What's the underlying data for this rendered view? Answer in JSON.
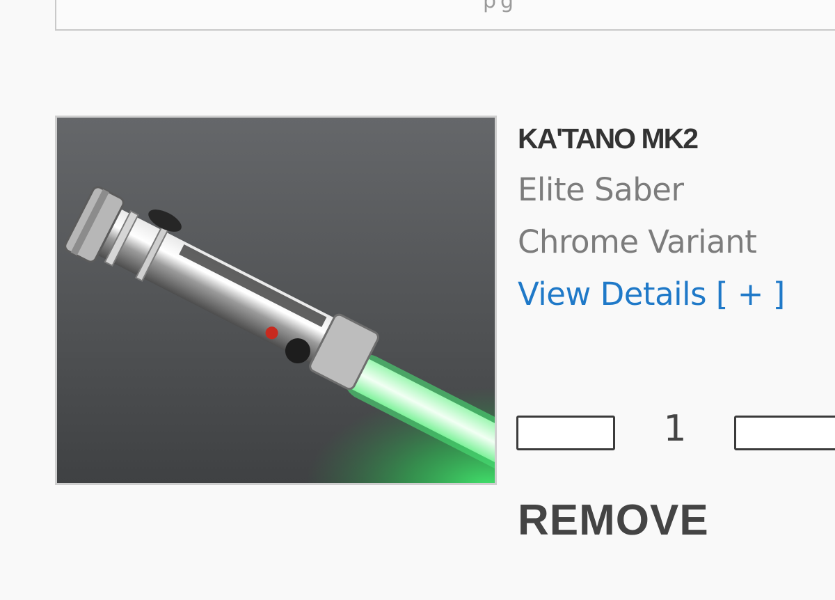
{
  "header": {
    "cut_text": "pg"
  },
  "product": {
    "image_alt": "KA'TANO MK2",
    "name": "KA'TANO MK2",
    "category": "Elite Saber",
    "variant": "Chrome Variant",
    "details_link": "View Details [ + ]",
    "quantity": "1",
    "remove_label": "REMOVE"
  },
  "colors": {
    "link": "#1f79c8",
    "text_dark": "#333333",
    "text_muted": "#7c7c7c",
    "blade_glow": "#3ee06a"
  },
  "icons": {
    "decrease": "minus-icon",
    "increase": "plus-icon"
  }
}
